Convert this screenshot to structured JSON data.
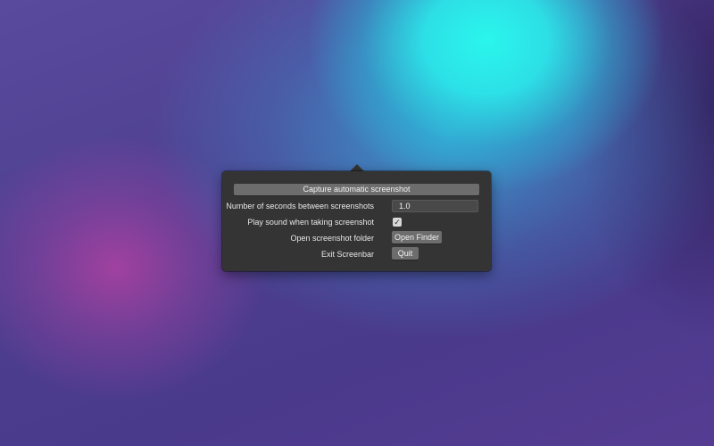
{
  "popover": {
    "capture_label": "Capture automatic screenshot",
    "seconds_label": "Number of seconds between screenshots",
    "seconds_value": "1.0",
    "sound_label": "Play sound when taking screenshot",
    "sound_checked": true,
    "sound_check_glyph": "✓",
    "open_folder_label": "Open screenshot folder",
    "open_finder_button": "Open Finder",
    "exit_label": "Exit Screenbar",
    "quit_button": "Quit"
  },
  "icons": {
    "checkbox": "checkmark-icon"
  }
}
